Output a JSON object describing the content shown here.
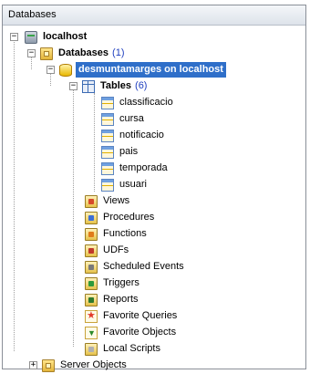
{
  "panel": {
    "title": "Databases"
  },
  "tree": {
    "localhost": "localhost",
    "databases": {
      "label": "Databases",
      "count": "(1)"
    },
    "connection": "desmuntamarges on localhost",
    "tables": {
      "label": "Tables",
      "count": "(6)"
    },
    "table_items": [
      "classificacio",
      "cursa",
      "notificacio",
      "pais",
      "temporada",
      "usuari"
    ],
    "objects": {
      "views": "Views",
      "procedures": "Procedures",
      "functions": "Functions",
      "udfs": "UDFs",
      "scheduled_events": "Scheduled Events",
      "triggers": "Triggers",
      "reports": "Reports",
      "favorite_queries": "Favorite Queries",
      "favorite_objects": "Favorite Objects",
      "local_scripts": "Local Scripts"
    },
    "server_objects": "Server Objects"
  },
  "expanders": {
    "collapse": "−",
    "expand": "+"
  }
}
